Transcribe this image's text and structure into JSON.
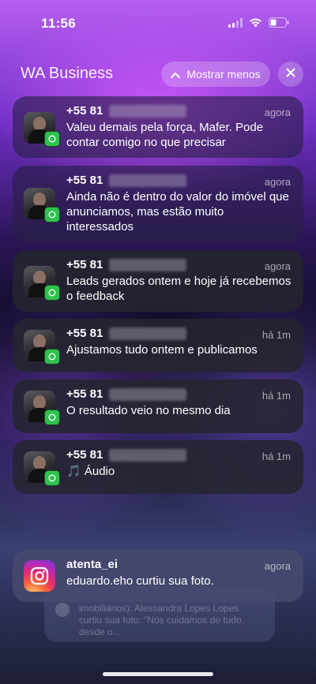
{
  "status": {
    "time": "11:56"
  },
  "header": {
    "group_title": "WA Business",
    "show_less_label": "Mostrar menos"
  },
  "notifications": [
    {
      "sender": "+55 81",
      "time": "agora",
      "message": "Valeu demais pela força, Mafer. Pode contar comigo no que precisar",
      "app": "whatsapp"
    },
    {
      "sender": "+55 81",
      "time": "agora",
      "message": "Ainda não é dentro do valor do imóvel que anunciamos, mas estão muito interessados",
      "app": "whatsapp"
    },
    {
      "sender": "+55 81",
      "time": "agora",
      "message": "Leads gerados ontem e hoje já recebemos o feedback",
      "app": "whatsapp"
    },
    {
      "sender": "+55 81",
      "time": "há 1m",
      "message": "Ajustamos tudo ontem e publicamos",
      "app": "whatsapp"
    },
    {
      "sender": "+55 81",
      "time": "há 1m",
      "message": "O resultado veio no mesmo dia",
      "app": "whatsapp"
    },
    {
      "sender": "+55 81",
      "time": "há 1m",
      "message": "🎵 Áudio",
      "app": "whatsapp"
    }
  ],
  "instagram": {
    "sender": "atenta_ei",
    "time": "agora",
    "message": "eduardo.eho curtiu sua foto."
  },
  "ghost_notification": {
    "text": "imobiliários): Alessandra Lopes Lopes curtiu sua foto: \"Nós cuidamos de tudo, desde o..."
  },
  "colors": {
    "whatsapp_badge": "#2ec24e",
    "instagram_accent": "#e42b6e"
  }
}
